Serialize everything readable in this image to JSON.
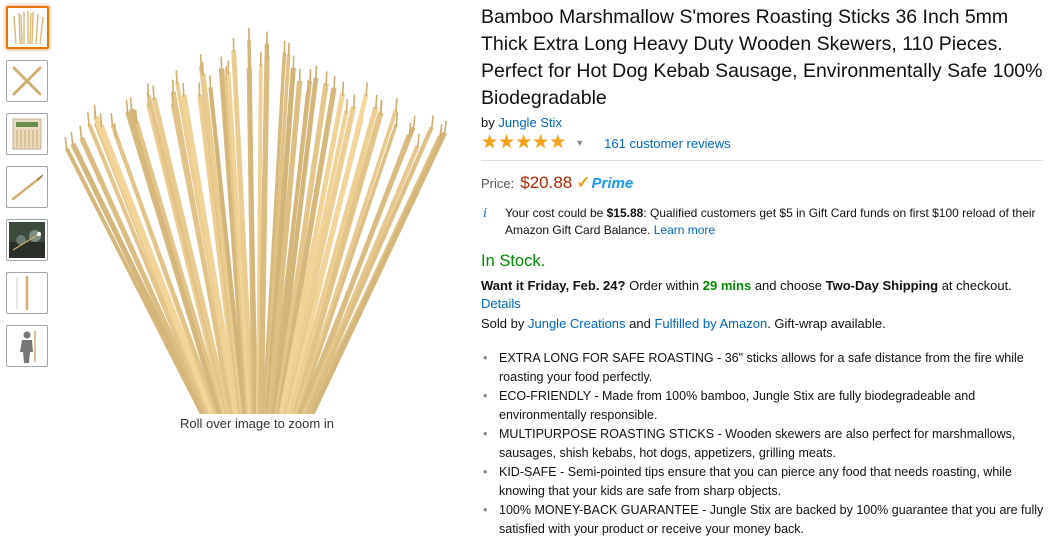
{
  "product": {
    "title": "Bamboo Marshmallow S'mores Roasting Sticks 36 Inch 5mm Thick Extra Long Heavy Duty Wooden Skewers, 110 Pieces. Perfect for Hot Dog Kebab Sausage, Environmentally Safe 100% Biodegradable",
    "by_prefix": "by",
    "brand": "Jungle Stix",
    "rating_stars": 5,
    "reviews_link": "161 customer reviews"
  },
  "image": {
    "zoom_caption": "Roll over image to zoom in",
    "thumbnails": [
      "sticks-bundle",
      "crossed-sticks",
      "package",
      "single-stick",
      "campfire-photo",
      "upright-stick",
      "person-scale"
    ]
  },
  "price": {
    "label": "Price:",
    "amount": "$20.88",
    "prime": "Prime"
  },
  "offer": {
    "cost_prefix": "Your cost could be ",
    "cost_amount": "$15.88",
    "cost_suffix": ": Qualified customers get $5 in Gift Card funds on first $100 reload of their Amazon Gift Card Balance. ",
    "learn_more": "Learn more"
  },
  "availability": {
    "stock": "In Stock.",
    "want_it": "Want it Friday, Feb. 24?",
    "order_within": " Order within ",
    "time_left": "29 mins",
    "choose": " and choose ",
    "shipping": "Two-Day Shipping",
    "at_checkout": " at checkout.",
    "details": "Details",
    "sold_by": "Sold by ",
    "seller": "Jungle Creations",
    "and": " and ",
    "fulfilled": "Fulfilled by Amazon",
    "gift": ". Gift-wrap available."
  },
  "bullets": [
    "EXTRA LONG FOR SAFE ROASTING - 36\" sticks allows for a safe distance from the fire while roasting your food perfectly.",
    "ECO-FRIENDLY - Made from 100% bamboo, Jungle Stix are fully biodegradeable and environmentally responsible.",
    "MULTIPURPOSE ROASTING STICKS - Wooden skewers are also perfect for marshmallows, sausages, shish kebabs, hot dogs, appetizers, grilling meats.",
    "KID-SAFE - Semi-pointed tips ensure that you can pierce any food that needs roasting, while knowing that your kids are safe from sharp objects.",
    "100% MONEY-BACK GUARANTEE - Jungle Stix are backed by 100% guarantee that you are fully satisfied with your product or receive your money back."
  ],
  "colors": {
    "link": "#0066c0",
    "price": "#b12704",
    "in_stock": "#008a00",
    "star": "#f4a41c",
    "thumb_selected": "#e77600"
  }
}
